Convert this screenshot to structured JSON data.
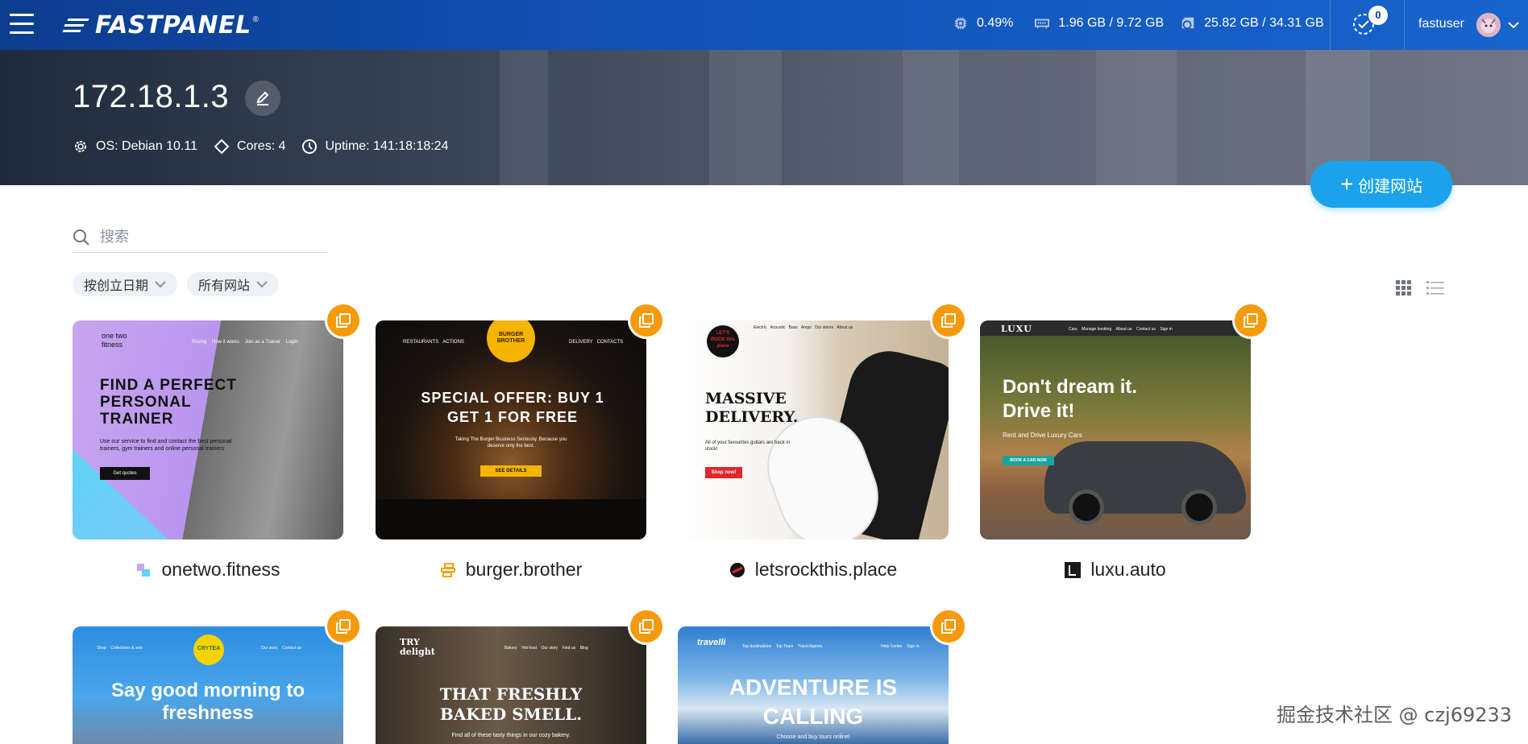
{
  "app": {
    "logo_text": "FASTPANEL",
    "logo_reg": "®"
  },
  "topbar": {
    "cpu": "0.49%",
    "ram": "1.96 GB / 9.72 GB",
    "disk": "25.82 GB / 34.31 GB",
    "notifications": "0",
    "username": "fastuser"
  },
  "server": {
    "ip": "172.18.1.3",
    "os": "OS: Debian 10.11",
    "cores": "Cores: 4",
    "uptime": "Uptime: 141:18:18:24"
  },
  "actions": {
    "create_site": "创建网站",
    "create_plus": "+"
  },
  "search": {
    "placeholder": "搜索"
  },
  "filters": [
    {
      "label": "按创立日期"
    },
    {
      "label": "所有网站"
    }
  ],
  "sites": [
    {
      "name": "onetwo.fitness",
      "thumb_headline": "FIND A PERFECT PERSONAL TRAINER",
      "thumb_logo": "one two fitness",
      "thumb_sub": "Use our service to find and contact the best personal trainers, gym trainers and online personal trainers",
      "thumb_button": "Get quotes",
      "thumb_nav": [
        "Pricing",
        "How it works",
        "Join as a Trainer",
        "Login"
      ]
    },
    {
      "name": "burger.brother",
      "thumb_headline": "SPECIAL OFFER: BUY 1 GET 1 FOR FREE",
      "thumb_logo": "BURGER BROTHER",
      "thumb_sub": "Taking The Burger Business Seriously. Because you deserve only the best.",
      "thumb_button": "SEE DETAILS",
      "thumb_nav": [
        "RESTAURANTS",
        "ACTIONS",
        "DELIVERY",
        "CONTACTS"
      ]
    },
    {
      "name": "letsrockthis.place",
      "thumb_headline": "MASSIVE DELIVERY.",
      "thumb_logo": "LET'S ROCK this place",
      "thumb_sub": "All of your favourites guitars are back in stock!",
      "thumb_button": "Shop now!",
      "thumb_nav": [
        "Electric",
        "Acoustic",
        "Bass",
        "Amps",
        "Our stores",
        "About us"
      ]
    },
    {
      "name": "luxu.auto",
      "thumb_headline": "Don't dream it. Drive it!",
      "thumb_logo": "LUXU",
      "thumb_sub": "Rent and Drive Luxury Cars",
      "thumb_button": "BOOK A CAR NOW",
      "thumb_nav": [
        "Cars",
        "Manage booking",
        "About us",
        "Contact us",
        "Sign in"
      ]
    },
    {
      "name": "",
      "thumb_headline": "Say good morning to freshness",
      "thumb_logo": "CRYTEA",
      "thumb_sub": "",
      "thumb_button": "",
      "thumb_nav": [
        "Shop",
        "Collections & sets",
        "Our story",
        "Contact us"
      ]
    },
    {
      "name": "",
      "thumb_headline": "THAT FRESHLY BAKED SMELL.",
      "thumb_logo": "TRY delight",
      "thumb_sub": "Find all of these tasty things in our cozy bakery.",
      "thumb_button": "",
      "thumb_nav": [
        "Bakery",
        "Hot food",
        "Our story",
        "Find us",
        "Blog"
      ]
    },
    {
      "name": "",
      "thumb_headline": "ADVENTURE IS CALLING",
      "thumb_logo": "travelli",
      "thumb_sub": "Choose and buy tours online!",
      "thumb_button": "",
      "thumb_nav": [
        "Top destinations",
        "Top Tours",
        "Travel Agents",
        "Help Center",
        "Sign in"
      ]
    }
  ],
  "watermark": "掘金技术社区 @ czj69233",
  "colors": {
    "accent": "#1aa3ec",
    "badge": "#f59a0a",
    "topbar": "#1253b8"
  }
}
